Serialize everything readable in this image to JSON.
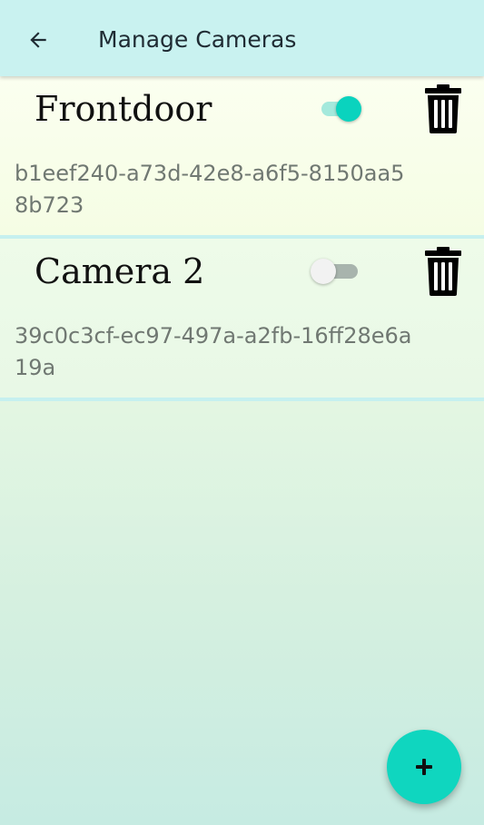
{
  "appbar": {
    "title": "Manage Cameras",
    "back_icon": "arrow-left-icon"
  },
  "cameras": [
    {
      "name": "Frontdoor",
      "id": "b1eef240-a73d-42e8-a6f5-8150aa58b723",
      "enabled": true,
      "delete_icon": "trash-icon"
    },
    {
      "name": "Camera 2",
      "id": "39c0c3cf-ec97-497a-a2fb-16ff28e6a19a",
      "enabled": false,
      "delete_icon": "trash-icon"
    }
  ],
  "fab": {
    "icon": "plus-icon"
  },
  "colors": {
    "appbar": "#c9f2f0",
    "accent": "#0fd6bf",
    "divider": "#c6f0ef"
  }
}
